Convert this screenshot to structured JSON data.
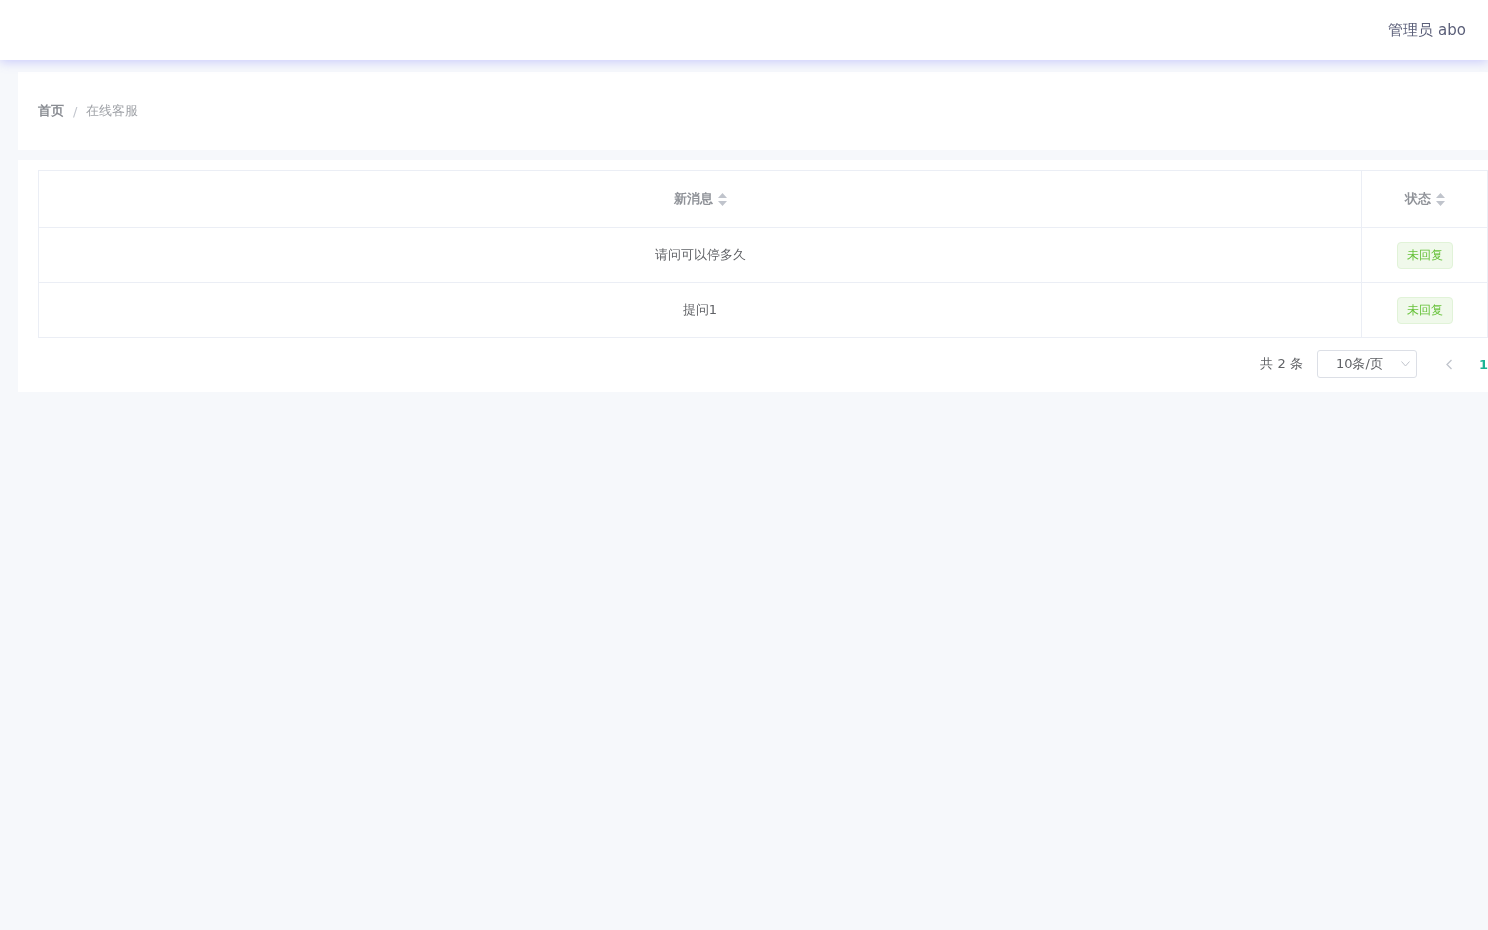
{
  "header": {
    "user": "管理员 abo"
  },
  "breadcrumb": [
    {
      "label": "首页",
      "current": false
    },
    {
      "label": "在线客服",
      "current": true
    }
  ],
  "breadcrumb_separator": "/",
  "table": {
    "columns": [
      "新消息",
      "状态"
    ],
    "rows": [
      {
        "message": "请问可以停多久",
        "status": "未回复"
      },
      {
        "message": "提问1",
        "status": "未回复"
      }
    ]
  },
  "pagination": {
    "total": "共 2 条",
    "page_size": "10条/页",
    "pages": [
      {
        "label": "1",
        "selected": true
      }
    ]
  }
}
